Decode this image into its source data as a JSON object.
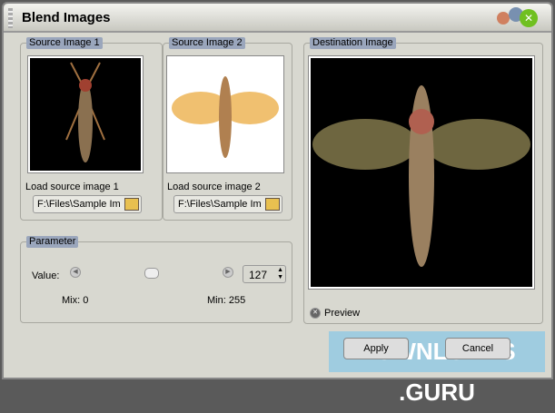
{
  "window": {
    "title": "Blend Images"
  },
  "source1": {
    "legend": "Source Image 1",
    "load_label": "Load source image 1",
    "path": "F:\\Files\\Sample Im"
  },
  "source2": {
    "legend": "Source Image 2",
    "load_label": "Load source image 2",
    "path": "F:\\Files\\Sample Im"
  },
  "destination": {
    "legend": "Destination Image",
    "preview_label": "Preview"
  },
  "parameter": {
    "legend": "Parameter",
    "value_label": "Value:",
    "value": "127",
    "slider_fraction": 0.5,
    "min_label": "Mix: 0",
    "max_label": "Min: 255"
  },
  "buttons": {
    "apply": "Apply",
    "cancel": "Cancel"
  },
  "watermark": "DOWNLOADS .GURU"
}
